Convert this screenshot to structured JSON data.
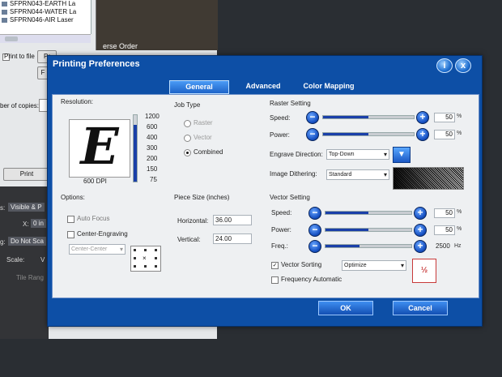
{
  "background": {
    "printers": [
      "SFPRN043-EARTH La",
      "SFPRN044-WATER La",
      "SFPRN046-AIR Laser"
    ],
    "print_to_file": "Print to file",
    "btn_p": "Pr",
    "btn_f": "F",
    "copies_label": "ber of copies:",
    "print_button": "Print",
    "erse_order": "erse Order",
    "panel": {
      "visible_label": "s:",
      "visible_value": "Visible & P",
      "x_label": "X:",
      "x_value": "0 in",
      "g_label": "g:",
      "g_value": "Do Not Sca",
      "scale_label": "Scale:",
      "scale_value": "V",
      "tile_label": "Tile Rang"
    }
  },
  "dialog": {
    "title": "Printing Preferences",
    "help_icon": "i",
    "close_icon": "x",
    "tabs": [
      "General",
      "Advanced",
      "Color Mapping"
    ],
    "active_tab": "General",
    "resolution": {
      "label": "Resolution:",
      "preview_letter": "E",
      "dpi_text": "600 DPI",
      "ticks": [
        "1200",
        "600",
        "400",
        "300",
        "200",
        "150",
        "75"
      ],
      "selected": "600"
    },
    "job_type": {
      "label": "Job Type",
      "options": [
        "Raster",
        "Vector",
        "Combined"
      ],
      "selected": "Combined"
    },
    "options": {
      "label": "Options:",
      "auto_focus": "Auto Focus",
      "center_engraving": "Center-Engraving",
      "center_select": "Center-Center"
    },
    "piece_size": {
      "label": "Piece Size (inches)",
      "horizontal_label": "Horizontal:",
      "horizontal": "36.00",
      "vertical_label": "Vertical:",
      "vertical": "24.00"
    },
    "raster": {
      "label": "Raster Setting",
      "speed_label": "Speed:",
      "speed": "50",
      "power_label": "Power:",
      "power": "50",
      "percent": "%",
      "engrave_direction_label": "Engrave Direction:",
      "engrave_direction": "Top-Down",
      "image_dithering_label": "Image Dithering:",
      "image_dithering": "Standard"
    },
    "vector": {
      "label": "Vector Setting",
      "speed_label": "Speed:",
      "speed": "50",
      "power_label": "Power:",
      "power": "50",
      "freq_label": "Freq.:",
      "freq": "2500",
      "freq_unit": "Hz",
      "percent": "%",
      "vector_sorting": "Vector Sorting",
      "vector_sorting_value": "Optimize",
      "frequency_automatic": "Frequency Automatic"
    },
    "ok": "OK",
    "cancel": "Cancel"
  }
}
